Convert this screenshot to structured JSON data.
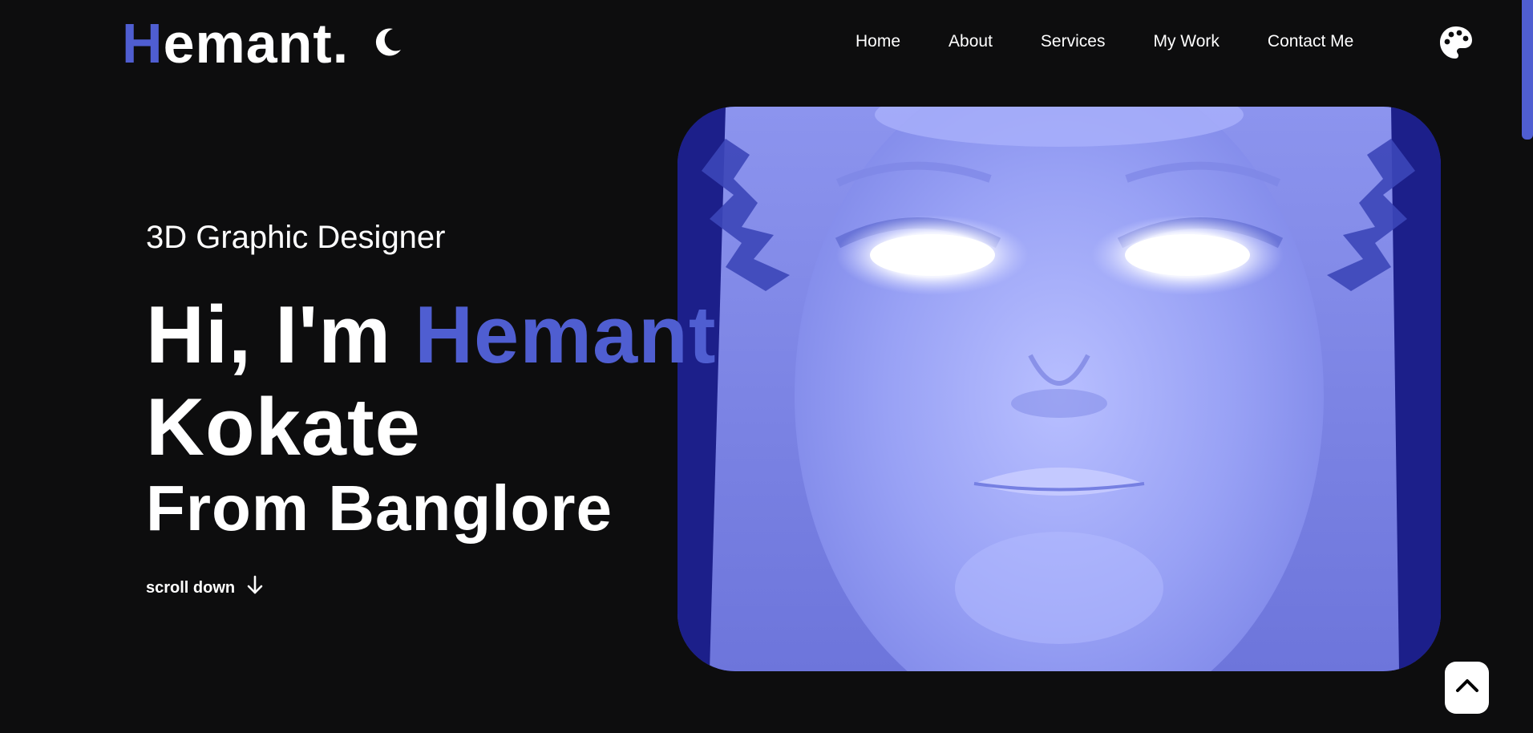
{
  "header": {
    "logo_initial": "H",
    "logo_rest": "emant.",
    "nav": [
      {
        "label": "Home"
      },
      {
        "label": "About"
      },
      {
        "label": "Services"
      },
      {
        "label": "My Work"
      },
      {
        "label": "Contact Me"
      }
    ],
    "icons": {
      "theme_toggle": "moon-icon",
      "palette": "palette-icon"
    }
  },
  "hero": {
    "subtitle": "3D Graphic Designer",
    "greeting": "Hi, I'm ",
    "first_name": "Hemant",
    "last_name": "Kokate",
    "location": "From Banglore",
    "scroll_label": "scroll down",
    "scroll_icon": "arrow-down-icon",
    "image_subject": "glowing-face-render"
  },
  "scroll_top": {
    "icon": "chevron-up-icon"
  },
  "colors": {
    "background": "#0d0d0e",
    "accent": "#4f5ed1",
    "text": "#ffffff"
  }
}
